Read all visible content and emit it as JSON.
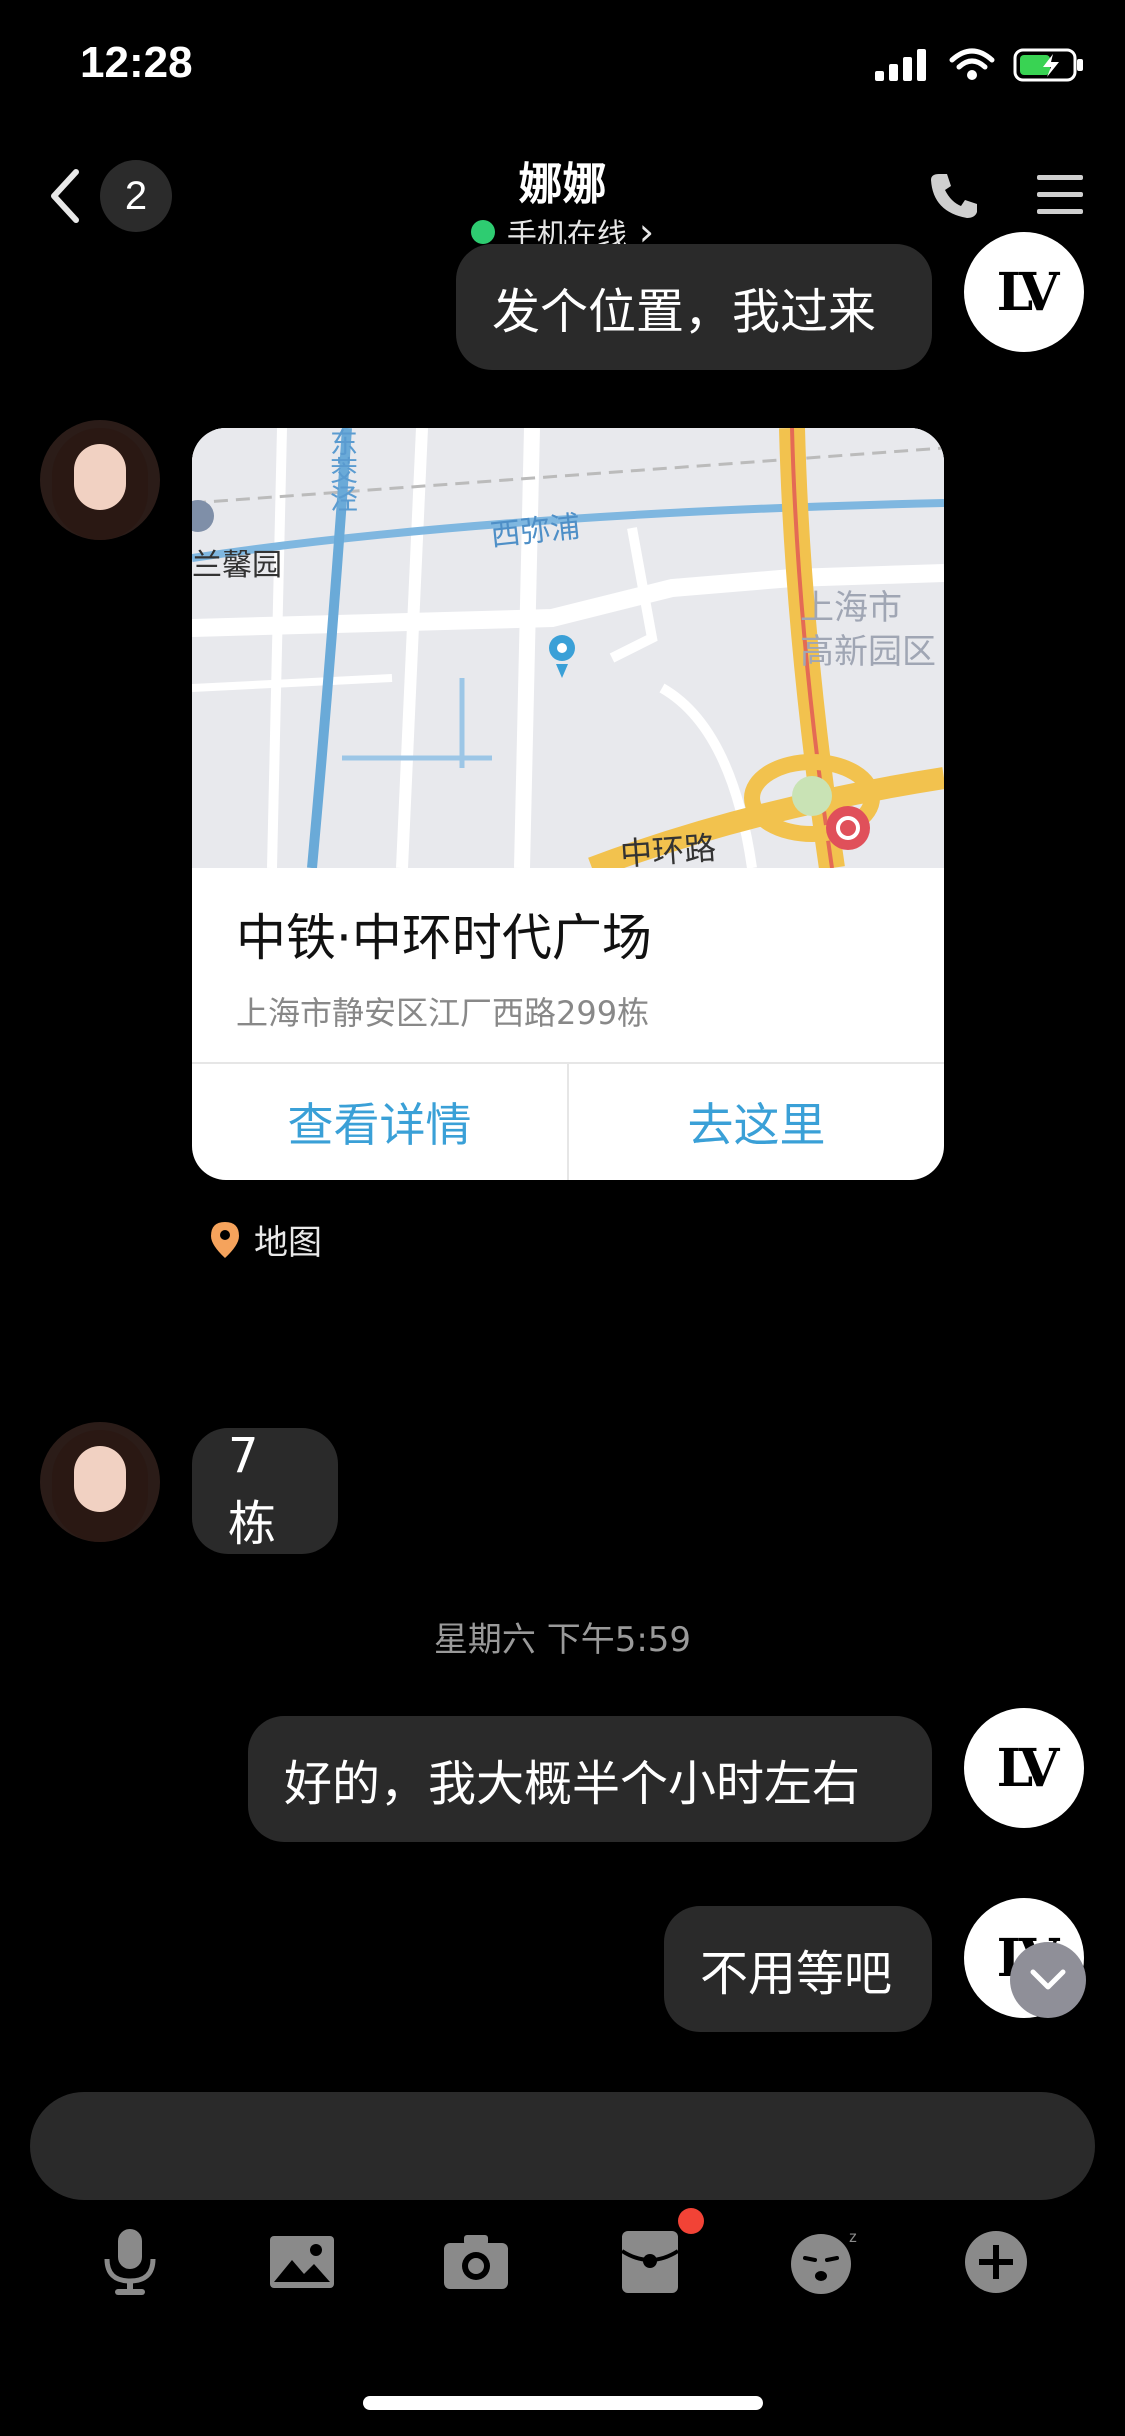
{
  "status_bar": {
    "time": "12:28"
  },
  "header": {
    "back_count": "2",
    "contact_name": "娜娜",
    "online_status": "手机在线",
    "chevron": "›"
  },
  "messages": [
    {
      "side": "right",
      "type": "text",
      "text": "发个位置，我过来"
    },
    {
      "side": "left",
      "type": "location",
      "place_name": "中铁·中环时代广场",
      "address": "上海市静安区江厂西路299栋",
      "actions": [
        "查看详情",
        "去这里"
      ],
      "source_label": "地图",
      "map_labels": {
        "canal": "西弥浦",
        "area_left": "兰馨园",
        "area_right_1": "上海市",
        "area_right_2": "高新园区",
        "road_bottom": "中环路",
        "vertical": "东茭泾"
      }
    },
    {
      "side": "left",
      "type": "text",
      "text": "7栋"
    },
    {
      "type": "timestamp",
      "text": "星期六 下午5:59"
    },
    {
      "side": "right",
      "type": "text",
      "text": "好的，我大概半个小时左右"
    },
    {
      "side": "right",
      "type": "text",
      "text": "不用等吧"
    }
  ],
  "toolbar": {
    "icons": [
      "microphone-icon",
      "image-icon",
      "camera-icon",
      "red-packet-icon",
      "emoji-icon",
      "plus-icon"
    ]
  },
  "colors": {
    "background": "#000000",
    "bubble": "#2a2a2a",
    "link_blue": "#3aa0d7",
    "online_green": "#2ecc71",
    "badge_red": "#f24336"
  }
}
